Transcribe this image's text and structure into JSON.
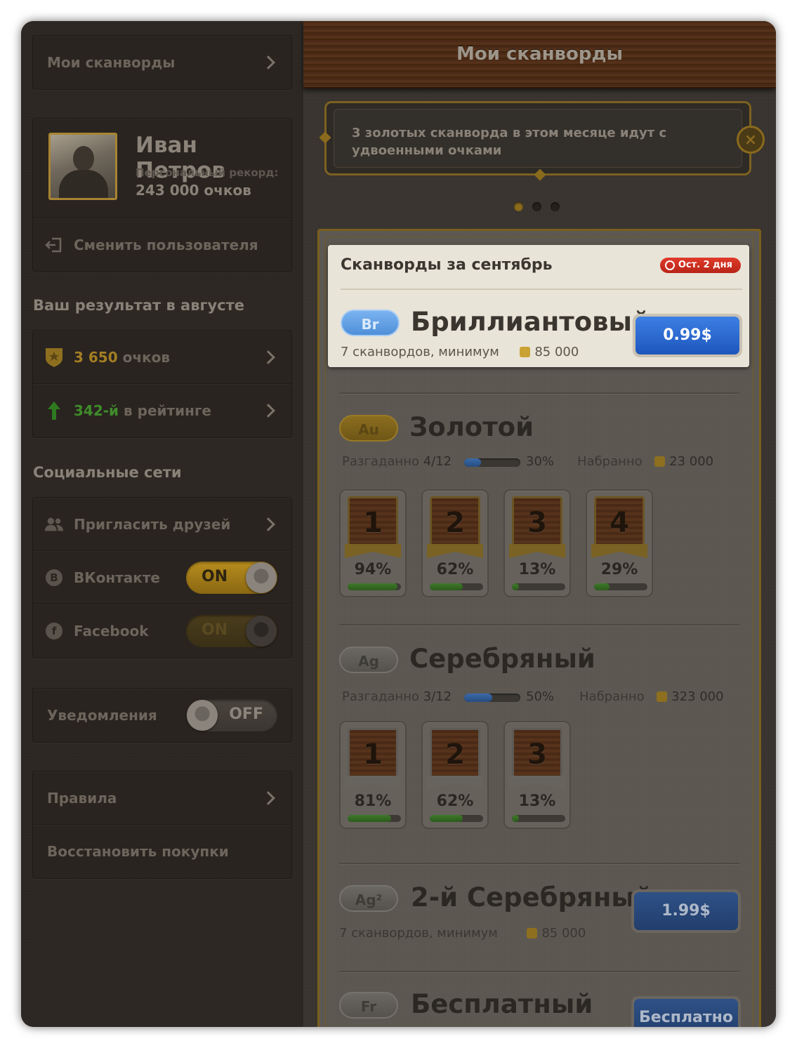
{
  "sidebar": {
    "my_scanwords": "Мои сканворды",
    "profile": {
      "name": "Иван Петров",
      "record_label": "Персональный рекорд:",
      "record_value": "243 000 очков",
      "switch_user": "Сменить пользователя"
    },
    "august_heading": "Ваш результат в августе",
    "score": {
      "value": "3 650",
      "unit": "очков"
    },
    "rating": {
      "value": "342-й",
      "suffix": "в рейтинге"
    },
    "social_heading": "Социальные сети",
    "invite_friends": "Пригласить друзей",
    "vk": {
      "letter": "B",
      "label": "ВКонтакте",
      "toggle": "ON"
    },
    "facebook": {
      "letter": "f",
      "label": "Facebook",
      "toggle": "ON"
    },
    "notifications": {
      "label": "Уведомления",
      "toggle": "OFF"
    },
    "rules": "Правила",
    "restore_purchases": "Восстановить покупки"
  },
  "main": {
    "title": "Мои сканворды",
    "banner": {
      "text": "3 золотых сканворда в этом месяце идут с удвоенными очками",
      "close": "×",
      "pages": 3,
      "active_page": 1
    },
    "month": {
      "title": "Сканворды за сентябрь",
      "badge": "Ост. 2 дня"
    },
    "tiers": {
      "diamond": {
        "code": "Br",
        "name": "Бриллиантовый",
        "desc": "7 сканвордов, минимум",
        "min_points": "85 000",
        "price": "0.99$"
      },
      "gold": {
        "code": "Au",
        "name": "Золотой",
        "solved_label": "Разгаданно",
        "solved": "4/12",
        "progress_pct": "30%",
        "progress": 0.3,
        "collected_label": "Набранно",
        "collected": "23 000",
        "cards": [
          {
            "number": "1",
            "pct": "94%",
            "fill": 0.94
          },
          {
            "number": "2",
            "pct": "62%",
            "fill": 0.62
          },
          {
            "number": "3",
            "pct": "13%",
            "fill": 0.13
          },
          {
            "number": "4",
            "pct": "29%",
            "fill": 0.29
          }
        ]
      },
      "silver": {
        "code": "Ag",
        "name": "Серебряный",
        "solved_label": "Разгаданно",
        "solved": "3/12",
        "progress_pct": "50%",
        "progress": 0.5,
        "collected_label": "Набранно",
        "collected": "323 000",
        "cards": [
          {
            "number": "1",
            "pct": "81%",
            "fill": 0.81
          },
          {
            "number": "2",
            "pct": "62%",
            "fill": 0.62
          },
          {
            "number": "3",
            "pct": "13%",
            "fill": 0.13
          }
        ]
      },
      "silver2": {
        "code": "Ag²",
        "name": "2-й Серебряный",
        "desc": "7 сканвордов, минимум",
        "min_points": "85 000",
        "price": "1.99$"
      },
      "free": {
        "code": "Fr",
        "name": "Бесплатный",
        "price": "Бесплатно"
      }
    }
  },
  "colors": {
    "gold_accent": "#b88d1e",
    "green_accent": "#3f8b2a",
    "blue_button": "#1e56bd",
    "badge_red": "#d0301f"
  }
}
